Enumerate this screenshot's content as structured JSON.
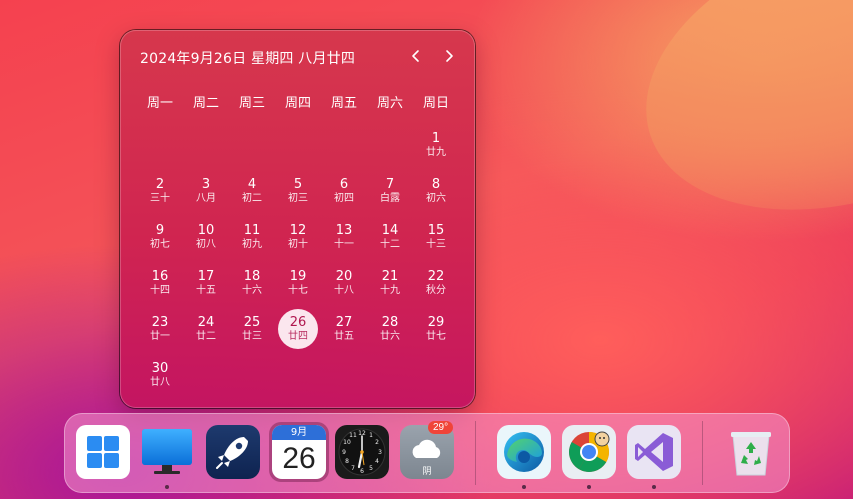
{
  "calendar": {
    "title": "2024年9月26日 星期四 八月廿四",
    "weekdays": [
      "周一",
      "周二",
      "周三",
      "周四",
      "周五",
      "周六",
      "周日"
    ],
    "leading_blanks": 6,
    "days": [
      {
        "day": "1",
        "lunar": "廿九"
      },
      {
        "day": "2",
        "lunar": "三十"
      },
      {
        "day": "3",
        "lunar": "八月"
      },
      {
        "day": "4",
        "lunar": "初二"
      },
      {
        "day": "5",
        "lunar": "初三"
      },
      {
        "day": "6",
        "lunar": "初四"
      },
      {
        "day": "7",
        "lunar": "白露"
      },
      {
        "day": "8",
        "lunar": "初六"
      },
      {
        "day": "9",
        "lunar": "初七"
      },
      {
        "day": "10",
        "lunar": "初八"
      },
      {
        "day": "11",
        "lunar": "初九"
      },
      {
        "day": "12",
        "lunar": "初十"
      },
      {
        "day": "13",
        "lunar": "十一"
      },
      {
        "day": "14",
        "lunar": "十二"
      },
      {
        "day": "15",
        "lunar": "十三"
      },
      {
        "day": "16",
        "lunar": "十四"
      },
      {
        "day": "17",
        "lunar": "十五"
      },
      {
        "day": "18",
        "lunar": "十六"
      },
      {
        "day": "19",
        "lunar": "十七"
      },
      {
        "day": "20",
        "lunar": "十八"
      },
      {
        "day": "21",
        "lunar": "十九"
      },
      {
        "day": "22",
        "lunar": "秋分"
      },
      {
        "day": "23",
        "lunar": "廿一"
      },
      {
        "day": "24",
        "lunar": "廿二"
      },
      {
        "day": "25",
        "lunar": "廿三"
      },
      {
        "day": "26",
        "lunar": "廿四",
        "today": true
      },
      {
        "day": "27",
        "lunar": "廿五"
      },
      {
        "day": "28",
        "lunar": "廿六"
      },
      {
        "day": "29",
        "lunar": "廿七"
      },
      {
        "day": "30",
        "lunar": "廿八"
      }
    ],
    "prev_icon": "chevron-left-icon",
    "next_icon": "chevron-right-icon"
  },
  "dock": {
    "calendar_icon": {
      "month": "9月",
      "day": "26"
    },
    "weather_icon": {
      "temp": "29°",
      "condition": "阴"
    },
    "items": [
      {
        "name": "start-menu-icon"
      },
      {
        "name": "desktop-icon"
      },
      {
        "name": "launcher-rocket-icon"
      },
      {
        "name": "calendar-app-icon"
      },
      {
        "name": "clock-app-icon"
      },
      {
        "name": "weather-app-icon"
      },
      {
        "name": "edge-browser-icon"
      },
      {
        "name": "chrome-browser-icon"
      },
      {
        "name": "visual-studio-icon"
      },
      {
        "name": "recycle-bin-icon"
      }
    ]
  },
  "colors": {
    "today_bg": "#fbe6ee",
    "today_text": "#b0174f"
  }
}
